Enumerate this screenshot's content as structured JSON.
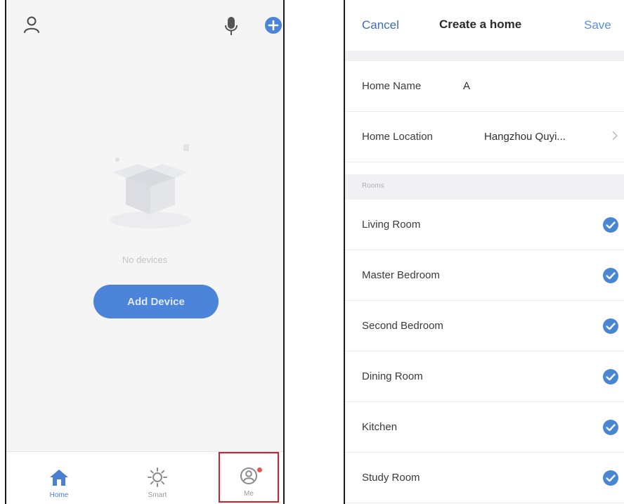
{
  "left_screen": {
    "empty_state": {
      "text": "No devices"
    },
    "add_device_label": "Add Device",
    "tabs": [
      {
        "label": "Home",
        "icon": "home-icon",
        "active": true
      },
      {
        "label": "Smart",
        "icon": "sun-icon",
        "active": false
      },
      {
        "label": "Me",
        "icon": "profile-icon",
        "active": false,
        "has_badge": true
      }
    ]
  },
  "right_screen": {
    "nav": {
      "cancel": "Cancel",
      "title": "Create a home",
      "save": "Save"
    },
    "home_name": {
      "label": "Home Name",
      "value": "A"
    },
    "home_location": {
      "label": "Home Location",
      "value": "Hangzhou Quyi..."
    },
    "rooms_header": "Rooms",
    "rooms": [
      {
        "name": "Living Room",
        "checked": true
      },
      {
        "name": "Master Bedroom",
        "checked": true
      },
      {
        "name": "Second Bedroom",
        "checked": true
      },
      {
        "name": "Dining Room",
        "checked": true
      },
      {
        "name": "Kitchen",
        "checked": true
      },
      {
        "name": "Study Room",
        "checked": true
      }
    ]
  },
  "colors": {
    "accent_blue": "#4b84d8",
    "check_blue": "#4a86d6",
    "highlight_red": "#d71f26",
    "badge_red": "#e8554f"
  }
}
